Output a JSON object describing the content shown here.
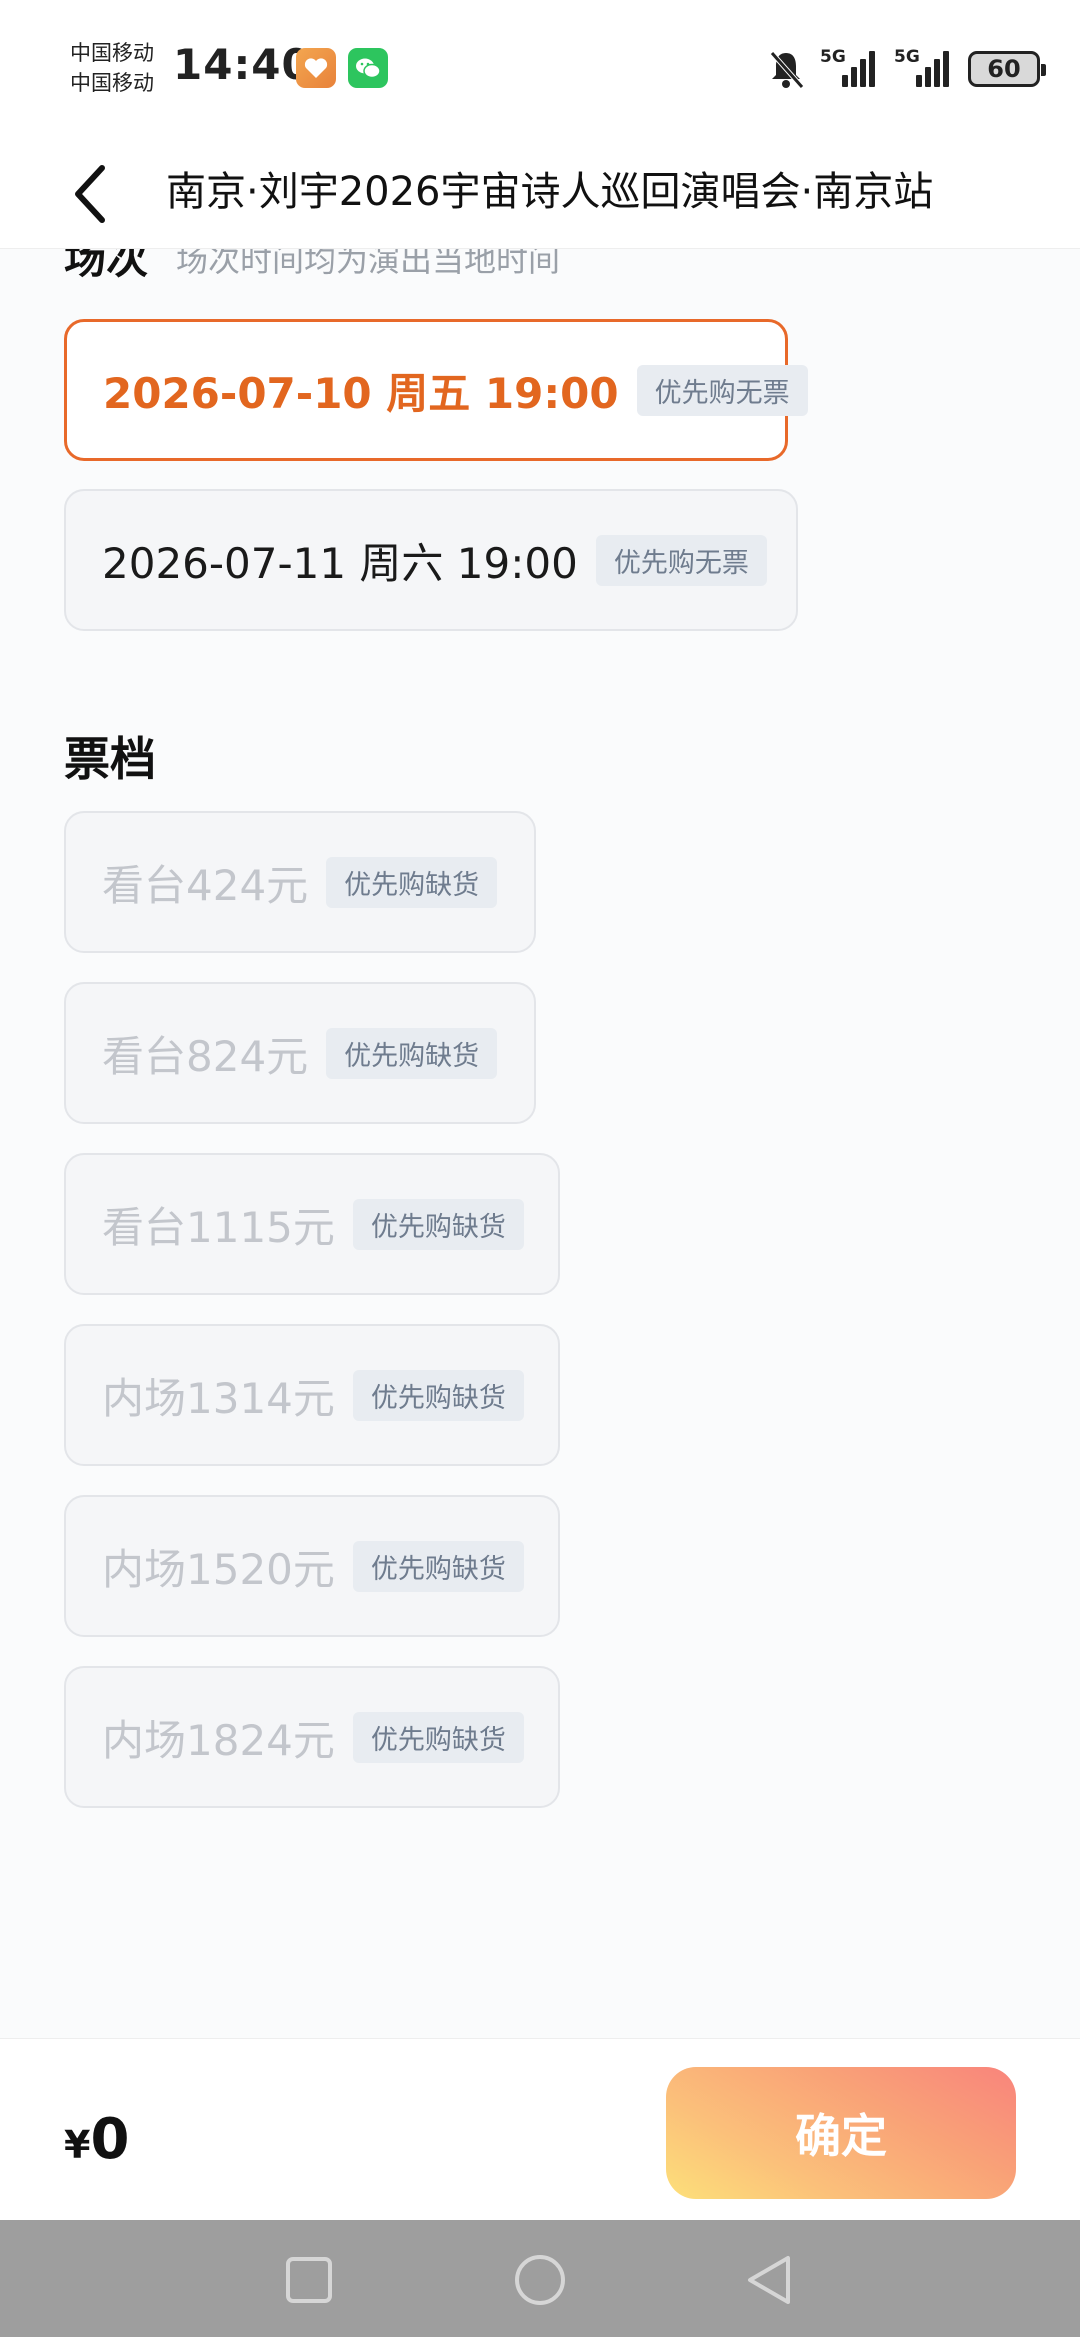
{
  "status_bar": {
    "carrier_1": "中国移动",
    "carrier_2": "中国移动",
    "time": "14:40",
    "apps": [
      "health-app-icon",
      "wechat-icon"
    ],
    "signal_1_label": "5G",
    "signal_2_label": "5G",
    "battery": "60"
  },
  "header": {
    "title": "南京·刘宇2026宇宙诗人巡回演唱会·南京站"
  },
  "sessions": {
    "title": "场次",
    "subtitle": "场次时间均为演出当地时间",
    "options": [
      {
        "label": "2026-07-10 周五 19:00",
        "tag": "优先购无票",
        "selected": true
      },
      {
        "label": "2026-07-11  周六 19:00",
        "tag": "优先购无票",
        "selected": false
      }
    ]
  },
  "tickets": {
    "title": "票档",
    "options": [
      {
        "label": "看台424元",
        "tag": "优先购缺货",
        "disabled": true
      },
      {
        "label": "看台824元",
        "tag": "优先购缺货",
        "disabled": true
      },
      {
        "label": "看台1115元",
        "tag": "优先购缺货",
        "disabled": true
      },
      {
        "label": "内场1314元",
        "tag": "优先购缺货",
        "disabled": true
      },
      {
        "label": "内场1520元",
        "tag": "优先购缺货",
        "disabled": true
      },
      {
        "label": "内场1824元",
        "tag": "优先购缺货",
        "disabled": true
      }
    ]
  },
  "footer": {
    "currency": "¥",
    "total": "0",
    "confirm_label": "确定"
  },
  "colors": {
    "accent": "#e2661f",
    "tag_bg": "#e8ecf1",
    "tag_text": "#6f7c8e",
    "disabled_text": "#c3c6cc",
    "button_gradient_start": "#fde07a",
    "button_gradient_end": "#f9847c"
  }
}
